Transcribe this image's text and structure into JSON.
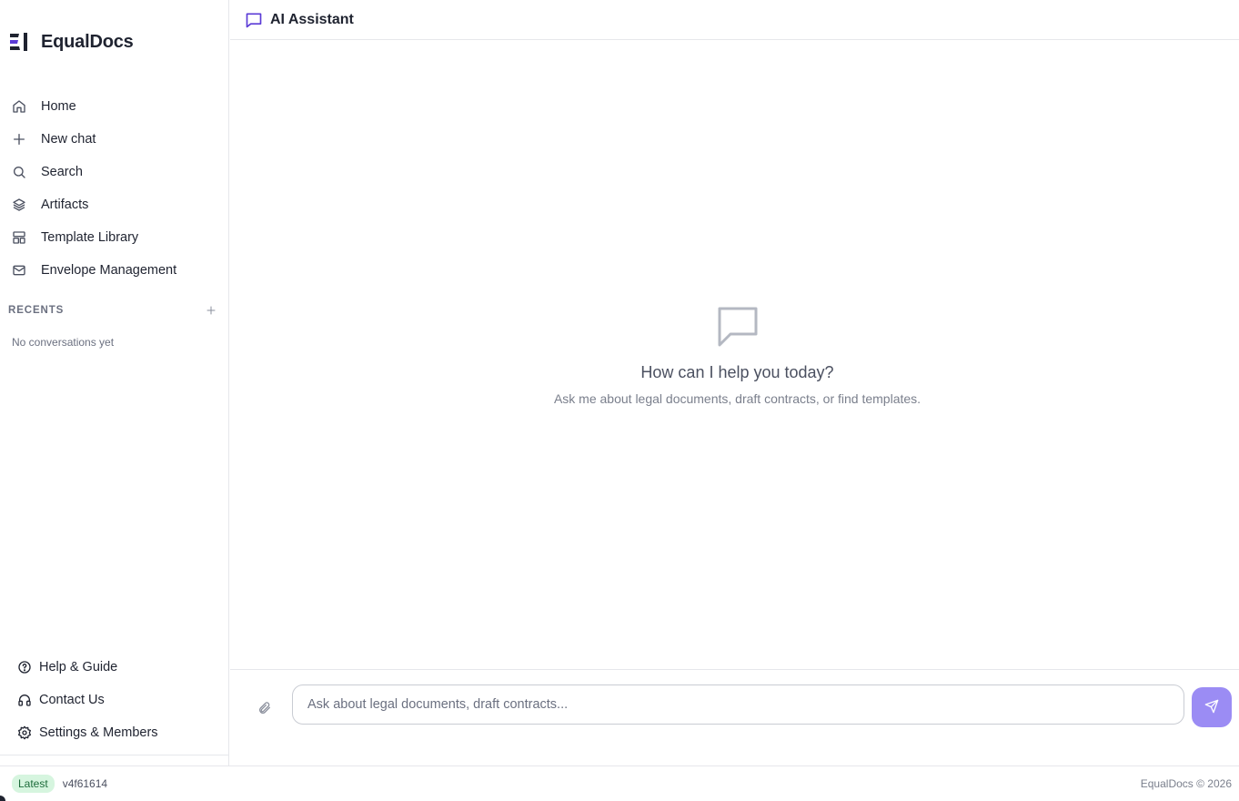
{
  "app": {
    "name": "EqualDocs",
    "brand_color": "#5b3bd6"
  },
  "sidebar": {
    "nav": [
      {
        "label": "Home",
        "icon": "home-icon"
      },
      {
        "label": "New chat",
        "icon": "plus-icon"
      },
      {
        "label": "Search",
        "icon": "search-icon"
      },
      {
        "label": "Artifacts",
        "icon": "layers-icon"
      },
      {
        "label": "Template Library",
        "icon": "layout-icon"
      },
      {
        "label": "Envelope Management",
        "icon": "mail-icon"
      }
    ],
    "recents": {
      "title": "RECENTS",
      "empty_text": "No conversations yet"
    },
    "footer": [
      {
        "label": "Help & Guide",
        "icon": "help-circle-icon"
      },
      {
        "label": "Contact Us",
        "icon": "headphones-icon"
      },
      {
        "label": "Settings & Members",
        "icon": "gear-icon"
      }
    ]
  },
  "header": {
    "title": "AI Assistant",
    "icon": "chat-bubble-icon"
  },
  "empty_state": {
    "headline": "How can I help you today?",
    "subtext": "Ask me about legal documents, draft contracts, or find templates."
  },
  "composer": {
    "placeholder": "Ask about legal documents, draft contracts...",
    "value": "",
    "send_color": "#9b8cf4"
  },
  "status": {
    "badge": "Latest",
    "version": "v4f61614",
    "copyright": "EqualDocs © 2026"
  }
}
